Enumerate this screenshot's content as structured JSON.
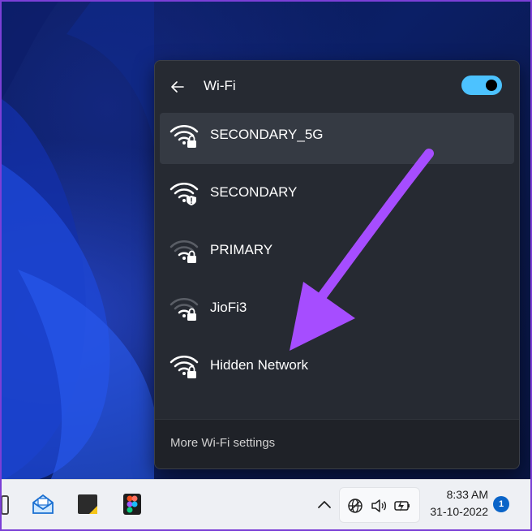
{
  "flyout": {
    "title": "Wi-Fi",
    "toggle_on": true,
    "accent_color": "#4cc2ff",
    "networks": [
      {
        "name": "SECONDARY_5G",
        "signal": "full",
        "secured": true,
        "selected": true
      },
      {
        "name": "SECONDARY",
        "signal": "full",
        "secured": true,
        "warning": true
      },
      {
        "name": "PRIMARY",
        "signal": "weak",
        "secured": true
      },
      {
        "name": "JioFi3",
        "signal": "weak",
        "secured": true
      },
      {
        "name": "Hidden Network",
        "signal": "full",
        "secured": true
      }
    ],
    "footer_link": "More Wi-Fi settings"
  },
  "annotation": {
    "arrow_color": "#a64dff"
  },
  "taskbar": {
    "apps": [
      "mail-icon",
      "sticky-notes-icon",
      "figma-icon"
    ],
    "tray_icons": [
      "globe-icon",
      "speaker-icon",
      "battery-icon"
    ],
    "time": "8:33 AM",
    "date": "31-10-2022",
    "notification_count": "1"
  }
}
